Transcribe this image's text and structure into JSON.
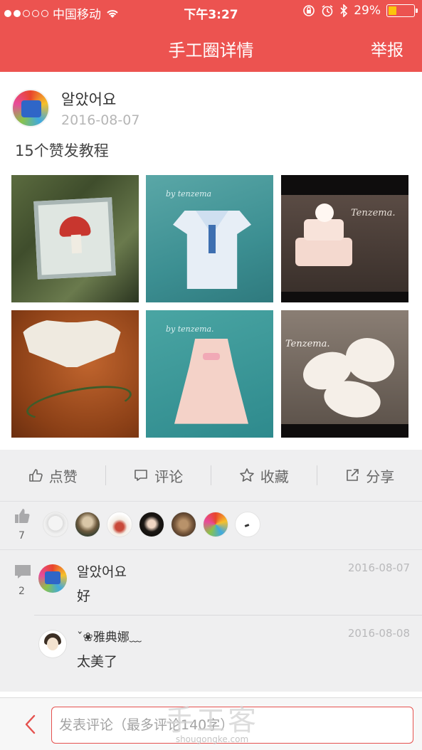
{
  "status_bar": {
    "carrier": "中国移动",
    "time": "下午3:27",
    "battery": "29%"
  },
  "nav": {
    "title": "手工圈详情",
    "report": "举报"
  },
  "post": {
    "author": "알았어요",
    "date": "2016-08-07",
    "text": "15个赞发教程",
    "image_labels": {
      "t2": "by tenzema",
      "t3": "Tenzema.",
      "t5": "by tenzema.",
      "t6": "Tenzema."
    }
  },
  "actions": {
    "like": "点赞",
    "comment": "评论",
    "favorite": "收藏",
    "share": "分享"
  },
  "likes": {
    "count": "7"
  },
  "comments": {
    "count": "2",
    "items": [
      {
        "author": "알았어요",
        "date": "2016-08-07",
        "text": "好"
      },
      {
        "author": "ˇ❀雅典娜﹏",
        "date": "2016-08-08",
        "text": "太美了"
      }
    ]
  },
  "bottom": {
    "placeholder": "发表评论（最多评论140字）"
  },
  "watermark": {
    "main": "手工客",
    "sub": "shougongke.com"
  },
  "colors": {
    "header": "#ec5350",
    "input_border": "#e5514e",
    "battery_fill": "#fcc40c"
  }
}
